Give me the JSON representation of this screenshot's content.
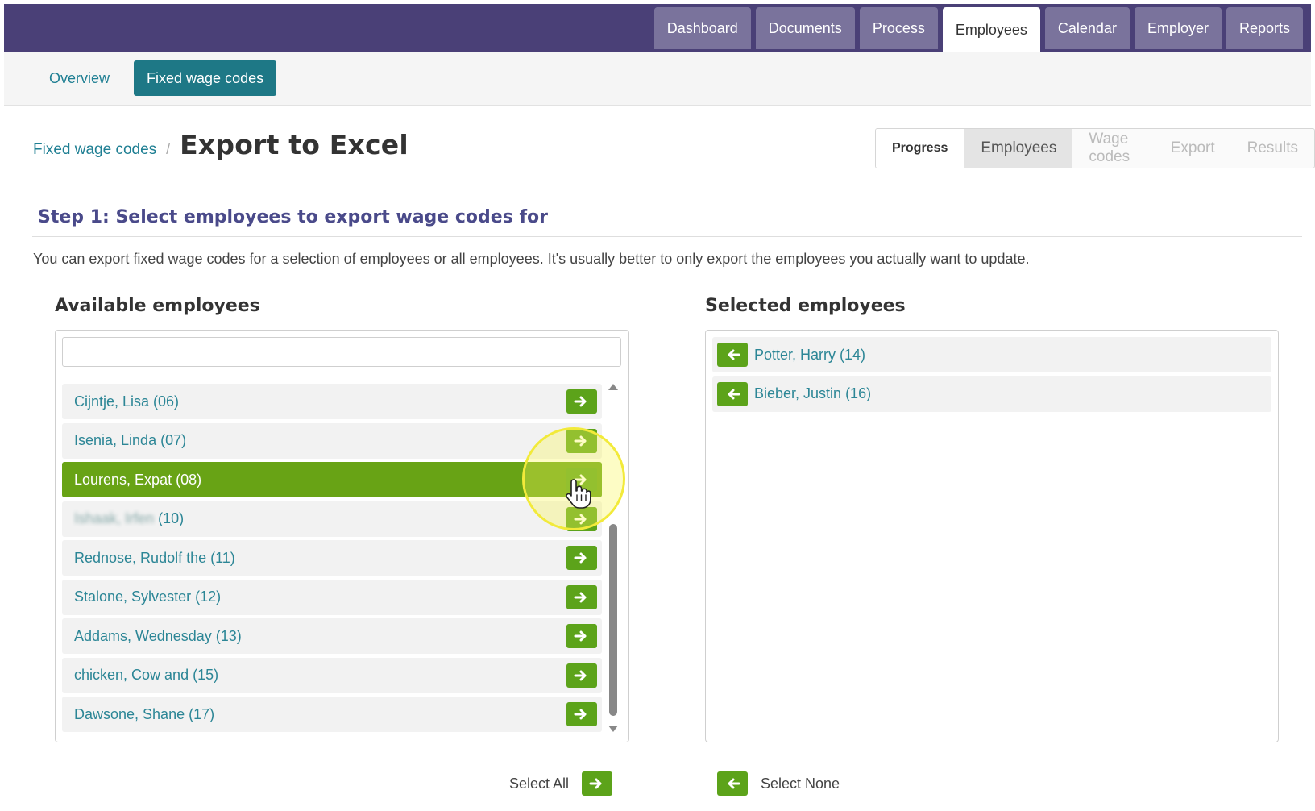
{
  "topnav": {
    "tabs": [
      {
        "label": "Dashboard"
      },
      {
        "label": "Documents"
      },
      {
        "label": "Process"
      },
      {
        "label": "Employees"
      },
      {
        "label": "Calendar"
      },
      {
        "label": "Employer"
      },
      {
        "label": "Reports"
      }
    ],
    "active": "Employees"
  },
  "subnav": {
    "items": [
      {
        "label": "Overview"
      },
      {
        "label": "Fixed wage codes"
      }
    ],
    "active": "Fixed wage codes"
  },
  "breadcrumb": {
    "link": "Fixed wage codes",
    "separator": "/",
    "title": "Export to Excel"
  },
  "wizard": {
    "steps": [
      {
        "label": "Progress"
      },
      {
        "label": "Employees"
      },
      {
        "label": "Wage codes"
      },
      {
        "label": "Export"
      },
      {
        "label": "Results"
      }
    ],
    "current": "Employees"
  },
  "step": {
    "heading": "Step 1: Select employees to export wage codes for",
    "description": "You can export fixed wage codes for a selection of employees or all employees. It's usually better to only export the employees you actually want to update."
  },
  "available": {
    "title": "Available employees",
    "search_value": "",
    "items": [
      {
        "name": "Cijntje, Lisa (06)"
      },
      {
        "name": "Isenia, Linda (07)"
      },
      {
        "name": "Lourens, Expat (08)"
      },
      {
        "name_blurred": "Ishaak, Irfen",
        "suffix": " (10)"
      },
      {
        "name": "Rednose, Rudolf the (11)"
      },
      {
        "name": "Stalone, Sylvester (12)"
      },
      {
        "name": "Addams, Wednesday (13)"
      },
      {
        "name": "chicken, Cow and (15)"
      },
      {
        "name": "Dawsone, Shane (17)"
      }
    ]
  },
  "selected": {
    "title": "Selected employees",
    "items": [
      {
        "name": "Potter, Harry (14)"
      },
      {
        "name": "Bieber, Justin (16)"
      }
    ]
  },
  "actions": {
    "select_all": "Select All",
    "select_none": "Select None"
  },
  "colors": {
    "nav_bg": "#4a4077",
    "accent_teal": "#1e7886",
    "green": "#5ca31a",
    "highlight_green": "#68a315"
  },
  "icons": {
    "add": "arrow-right-icon",
    "remove": "arrow-left-icon"
  }
}
